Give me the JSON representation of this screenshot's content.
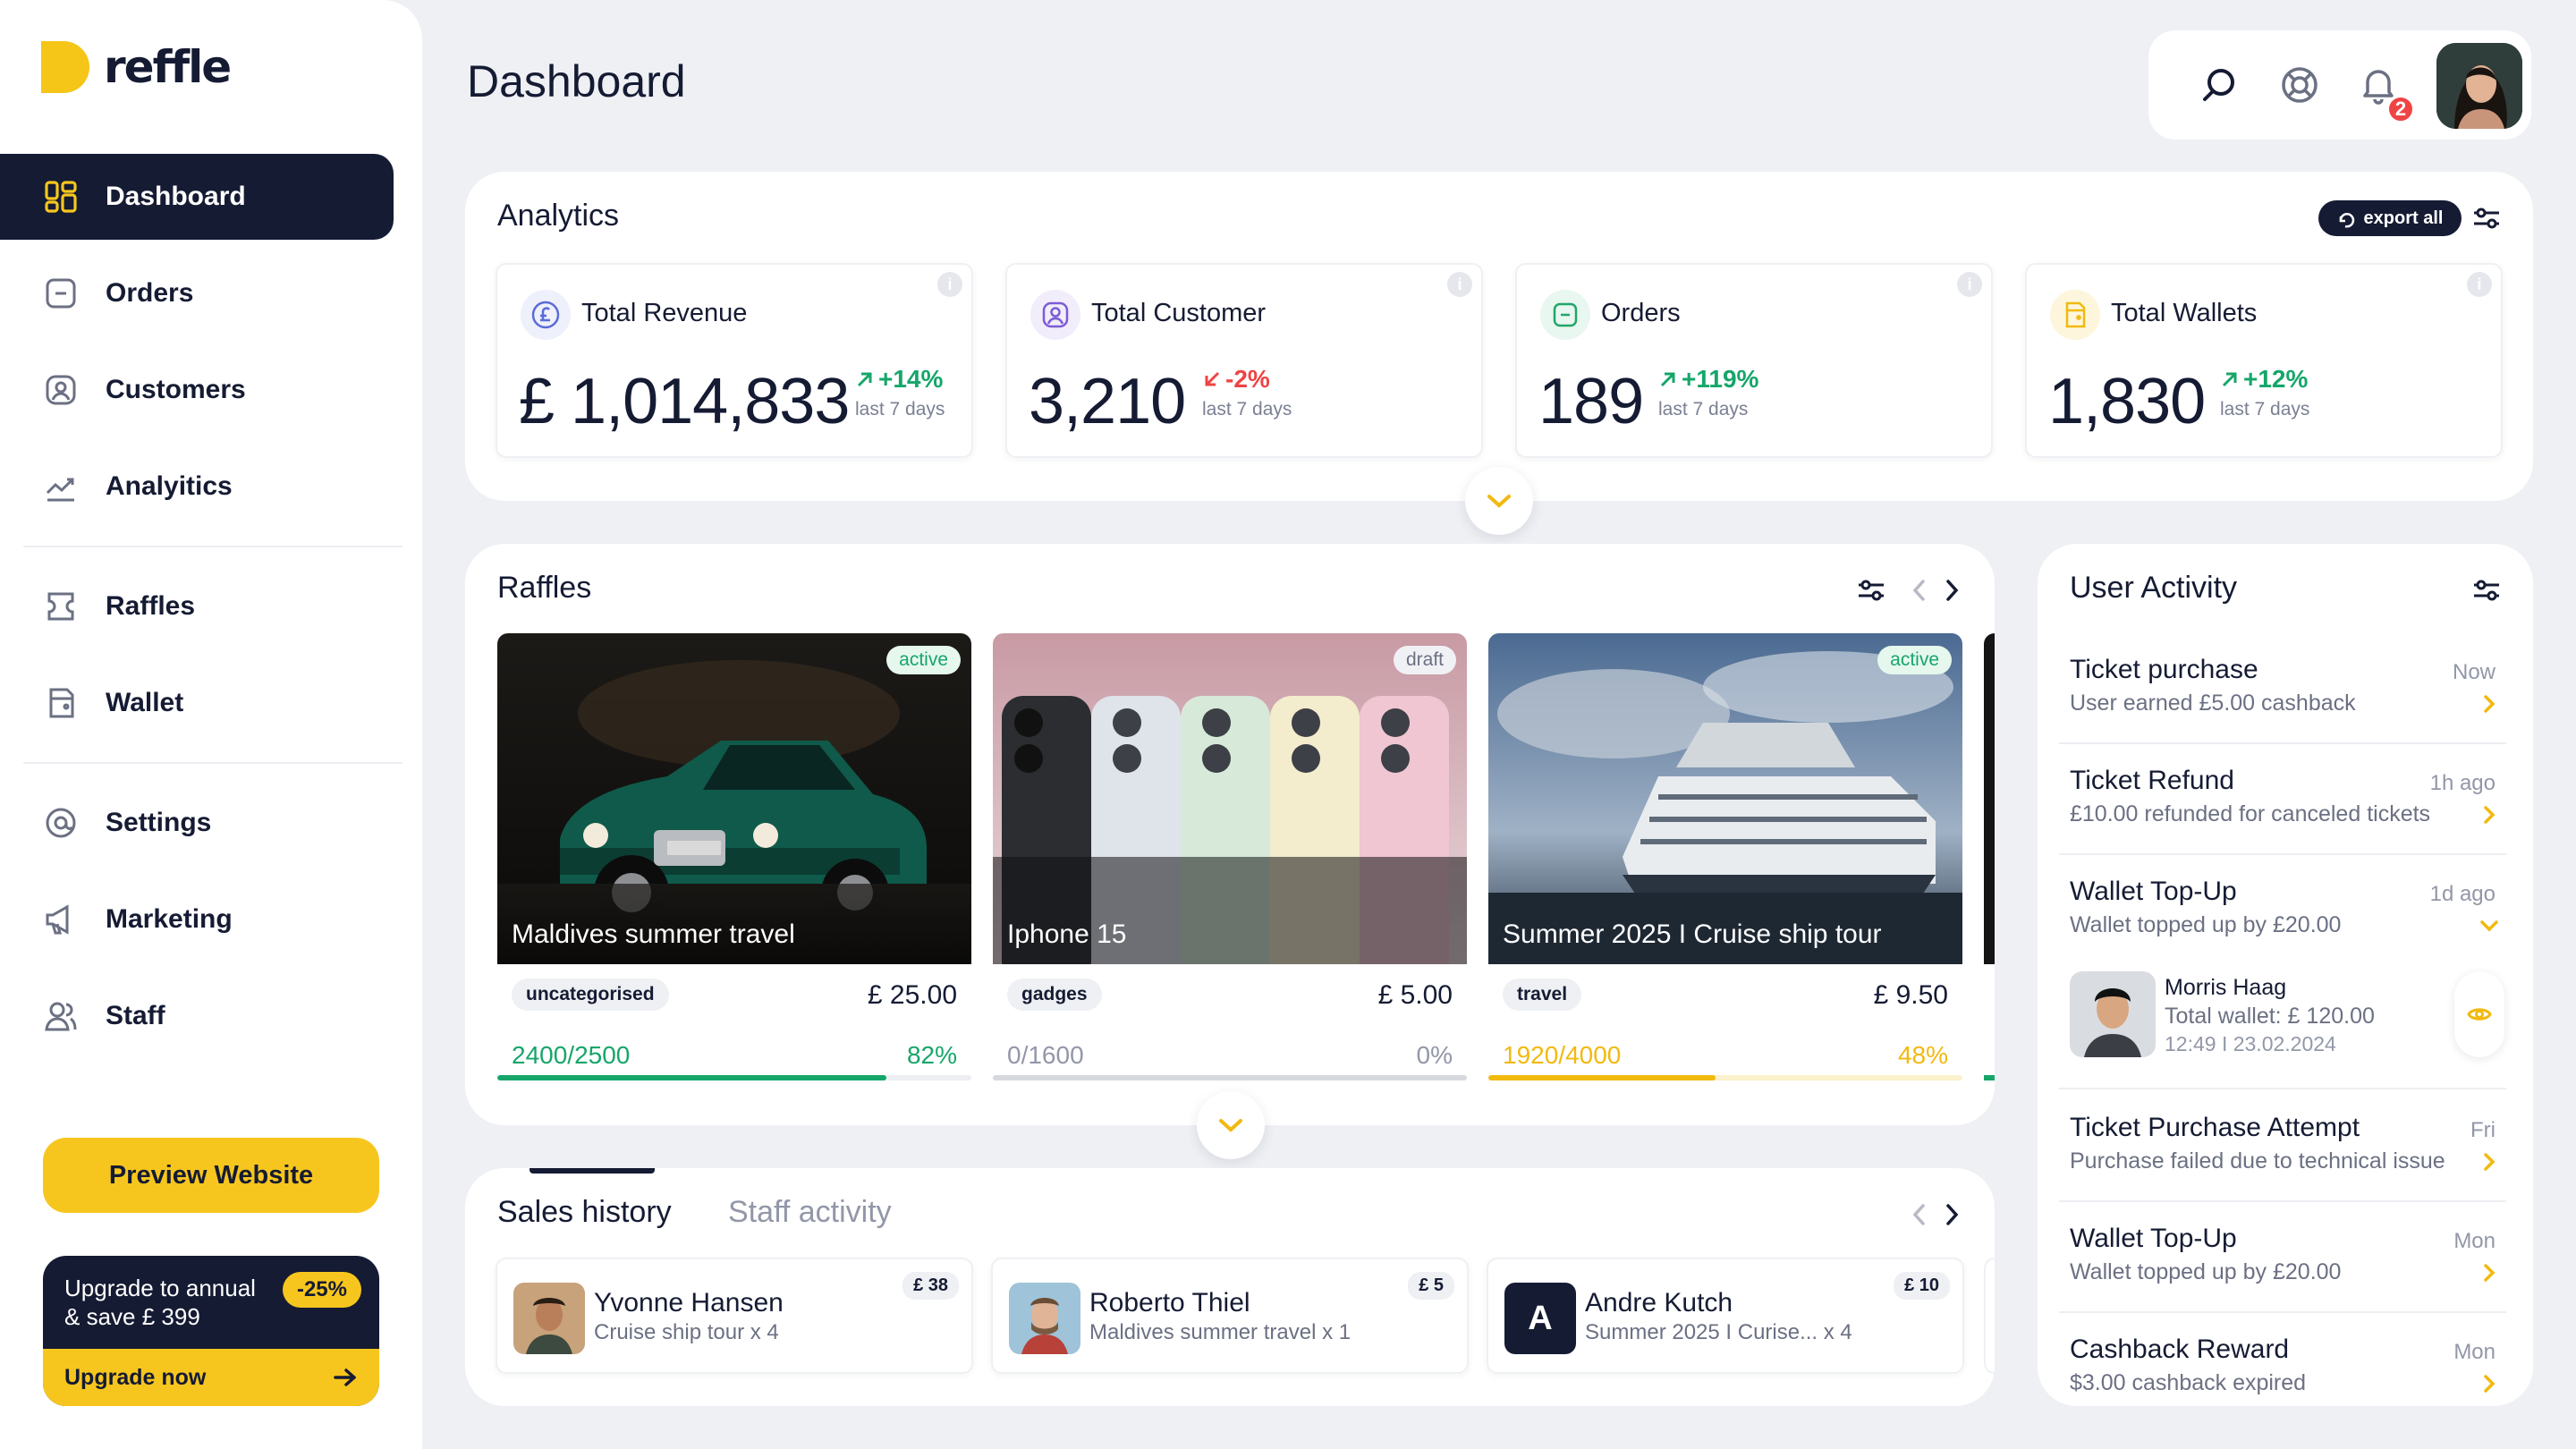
{
  "app": {
    "logo_text": "reffle",
    "page_title": "Dashboard"
  },
  "sidebar": {
    "items": [
      {
        "label": "Dashboard",
        "icon": "dashboard-icon",
        "active": true
      },
      {
        "label": "Orders",
        "icon": "orders-icon"
      },
      {
        "label": "Customers",
        "icon": "customers-icon"
      },
      {
        "label": "Analyitics",
        "icon": "analytics-icon"
      },
      {
        "label": "Raffles",
        "icon": "ticket-icon"
      },
      {
        "label": "Wallet",
        "icon": "wallet-icon"
      },
      {
        "label": "Settings",
        "icon": "settings-icon"
      },
      {
        "label": "Marketing",
        "icon": "megaphone-icon"
      },
      {
        "label": "Staff",
        "icon": "staff-icon"
      }
    ],
    "preview_button": "Preview Website",
    "upgrade": {
      "line1": "Upgrade to annual",
      "line2": "& save £ 399",
      "badge": "-25%",
      "cta": "Upgrade now"
    }
  },
  "header": {
    "notifications_count": "2",
    "icons": [
      "search-icon",
      "help-icon",
      "bell-icon"
    ]
  },
  "analytics": {
    "title": "Analytics",
    "export_label": "export all",
    "period": "last 7 days",
    "stats": [
      {
        "label": "Total Revenue",
        "value": "£ 1,014,833",
        "change": "+14%",
        "trend": "up",
        "icon": "pound-icon",
        "color": "#5b6bd6",
        "bg": "#eef0fb"
      },
      {
        "label": "Total Customer",
        "value": "3,210",
        "change": "-2%",
        "trend": "down",
        "icon": "user-icon",
        "color": "#7c5cd6",
        "bg": "#f1edfb"
      },
      {
        "label": "Orders",
        "value": "189",
        "change": "+119%",
        "trend": "up",
        "icon": "order-icon",
        "color": "#22a66a",
        "bg": "#e8f7ef"
      },
      {
        "label": "Total Wallets",
        "value": "1,830",
        "change": "+12%",
        "trend": "up",
        "icon": "wallet-icon",
        "color": "#f2b90f",
        "bg": "#fdf6dc"
      }
    ]
  },
  "raffles": {
    "title": "Raffles",
    "items": [
      {
        "name": "Maldives summer travel",
        "status": "active",
        "category": "uncategorised",
        "price": "£ 25.00",
        "sold": "2400/2500",
        "percent": "82%",
        "progress": 0.82,
        "color": "#16a66a"
      },
      {
        "name": "Iphone 15",
        "status": "draft",
        "category": "gadges",
        "price": "£ 5.00",
        "sold": "0/1600",
        "percent": "0%",
        "progress": 0,
        "color": "#9297a8"
      },
      {
        "name": "Summer 2025 I Cruise ship tour",
        "status": "active",
        "category": "travel",
        "price": "£ 9.50",
        "sold": "1920/4000",
        "percent": "48%",
        "progress": 0.48,
        "color": "#f2b90f"
      }
    ]
  },
  "sales": {
    "tabs": [
      "Sales history",
      "Staff activity"
    ],
    "items": [
      {
        "name": "Yvonne Hansen",
        "desc": "Cruise ship tour x 4",
        "amount": "£ 38"
      },
      {
        "name": "Roberto Thiel",
        "desc": "Maldives summer travel x 1",
        "amount": "£ 5"
      },
      {
        "name": "Andre Kutch",
        "desc": "Summer 2025 I Curise... x 4",
        "amount": "£ 10",
        "initial": "A"
      }
    ]
  },
  "user_activity": {
    "title": "User Activity",
    "items": [
      {
        "title": "Ticket purchase",
        "desc": "User earned £5.00 cashback",
        "time": "Now"
      },
      {
        "title": "Ticket Refund",
        "desc": "£10.00 refunded for canceled tickets",
        "time": "1h ago"
      },
      {
        "title": "Wallet Top-Up",
        "desc": "Wallet topped up by £20.00",
        "time": "1d ago"
      },
      {
        "title": "Ticket Purchase Attempt",
        "desc": "Purchase failed due to technical issue",
        "time": "Fri"
      },
      {
        "title": "Wallet Top-Up",
        "desc": "Wallet topped up by £20.00",
        "time": "Mon"
      },
      {
        "title": "Cashback Reward",
        "desc": "$3.00 cashback expired",
        "time": "Mon"
      }
    ],
    "detail": {
      "name": "Morris Haag",
      "line": "Total wallet: £ 120.00",
      "time": "12:49 I 23.02.2024"
    }
  }
}
